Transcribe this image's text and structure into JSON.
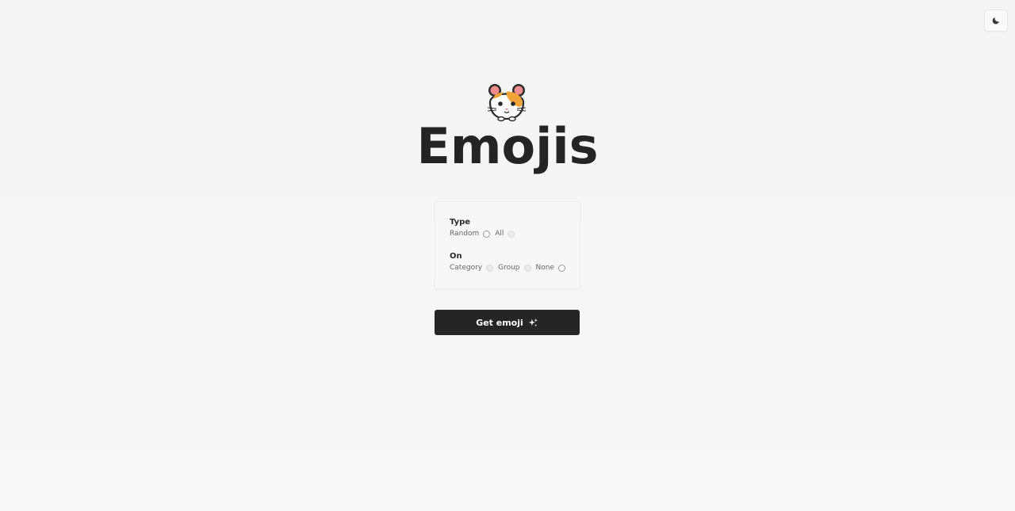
{
  "header": {
    "theme_toggle_icon": "moon-icon"
  },
  "hero": {
    "logo_icon": "hamster-face-icon",
    "title": "Emojis"
  },
  "options": {
    "type_group": {
      "label": "Type",
      "options": [
        {
          "label": "Random",
          "selected": false
        },
        {
          "label": "All",
          "selected": false
        }
      ]
    },
    "on_group": {
      "label": "On",
      "options": [
        {
          "label": "Category",
          "selected": false
        },
        {
          "label": "Group",
          "selected": false
        },
        {
          "label": "None",
          "selected": false
        }
      ]
    }
  },
  "action": {
    "button_label": "Get emoji",
    "button_icon": "sparkles-icon"
  },
  "colors": {
    "background": "#f5f5f5",
    "button_bg": "#252525",
    "button_text": "#ffffff",
    "title": "#242424"
  }
}
